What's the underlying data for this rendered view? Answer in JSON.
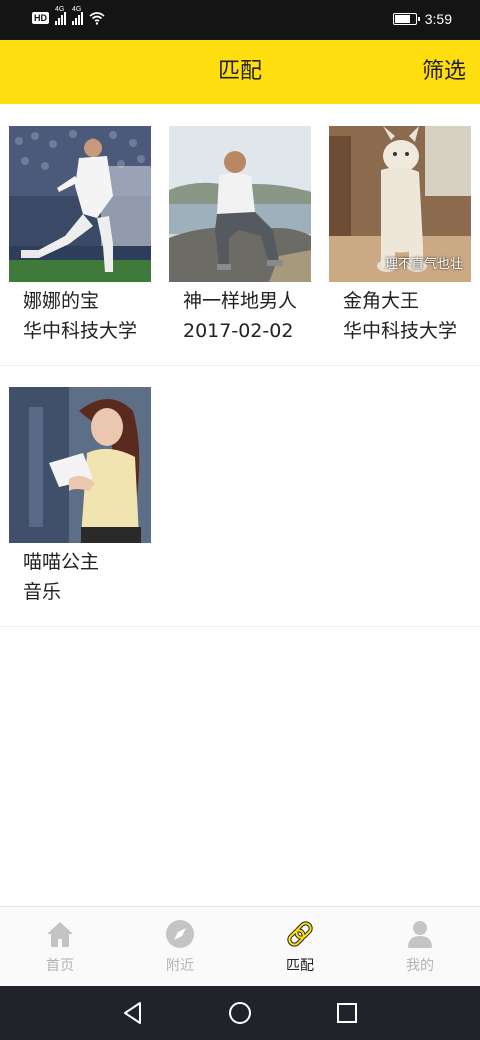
{
  "status_bar": {
    "hd_badge": "HD",
    "network_1": "4G",
    "network_2": "4G",
    "battery_level": 0.8,
    "time": "3:59"
  },
  "header": {
    "title": "匹配",
    "filter_label": "筛选",
    "background_color": "#ffde0f"
  },
  "matches": [
    {
      "name": "娜娜的宝",
      "detail": "华中科技大学"
    },
    {
      "name": "神一样地男人",
      "detail": "2017-02-02"
    },
    {
      "name": "金角大王",
      "detail": "华中科技大学",
      "photo_caption": "理不直气也壮"
    },
    {
      "name": "喵喵公主",
      "detail": "音乐"
    }
  ],
  "bottom_nav": {
    "items": [
      {
        "label": "首页",
        "icon": "home-icon",
        "active": false
      },
      {
        "label": "附近",
        "icon": "compass-icon",
        "active": false
      },
      {
        "label": "匹配",
        "icon": "link-icon",
        "active": true
      },
      {
        "label": "我的",
        "icon": "user-icon",
        "active": false
      }
    ],
    "active_color": "#ffde0f",
    "inactive_color": "#c4c4c4"
  },
  "system_nav": {
    "buttons": [
      "back-icon",
      "home-circle-icon",
      "recents-icon"
    ]
  }
}
